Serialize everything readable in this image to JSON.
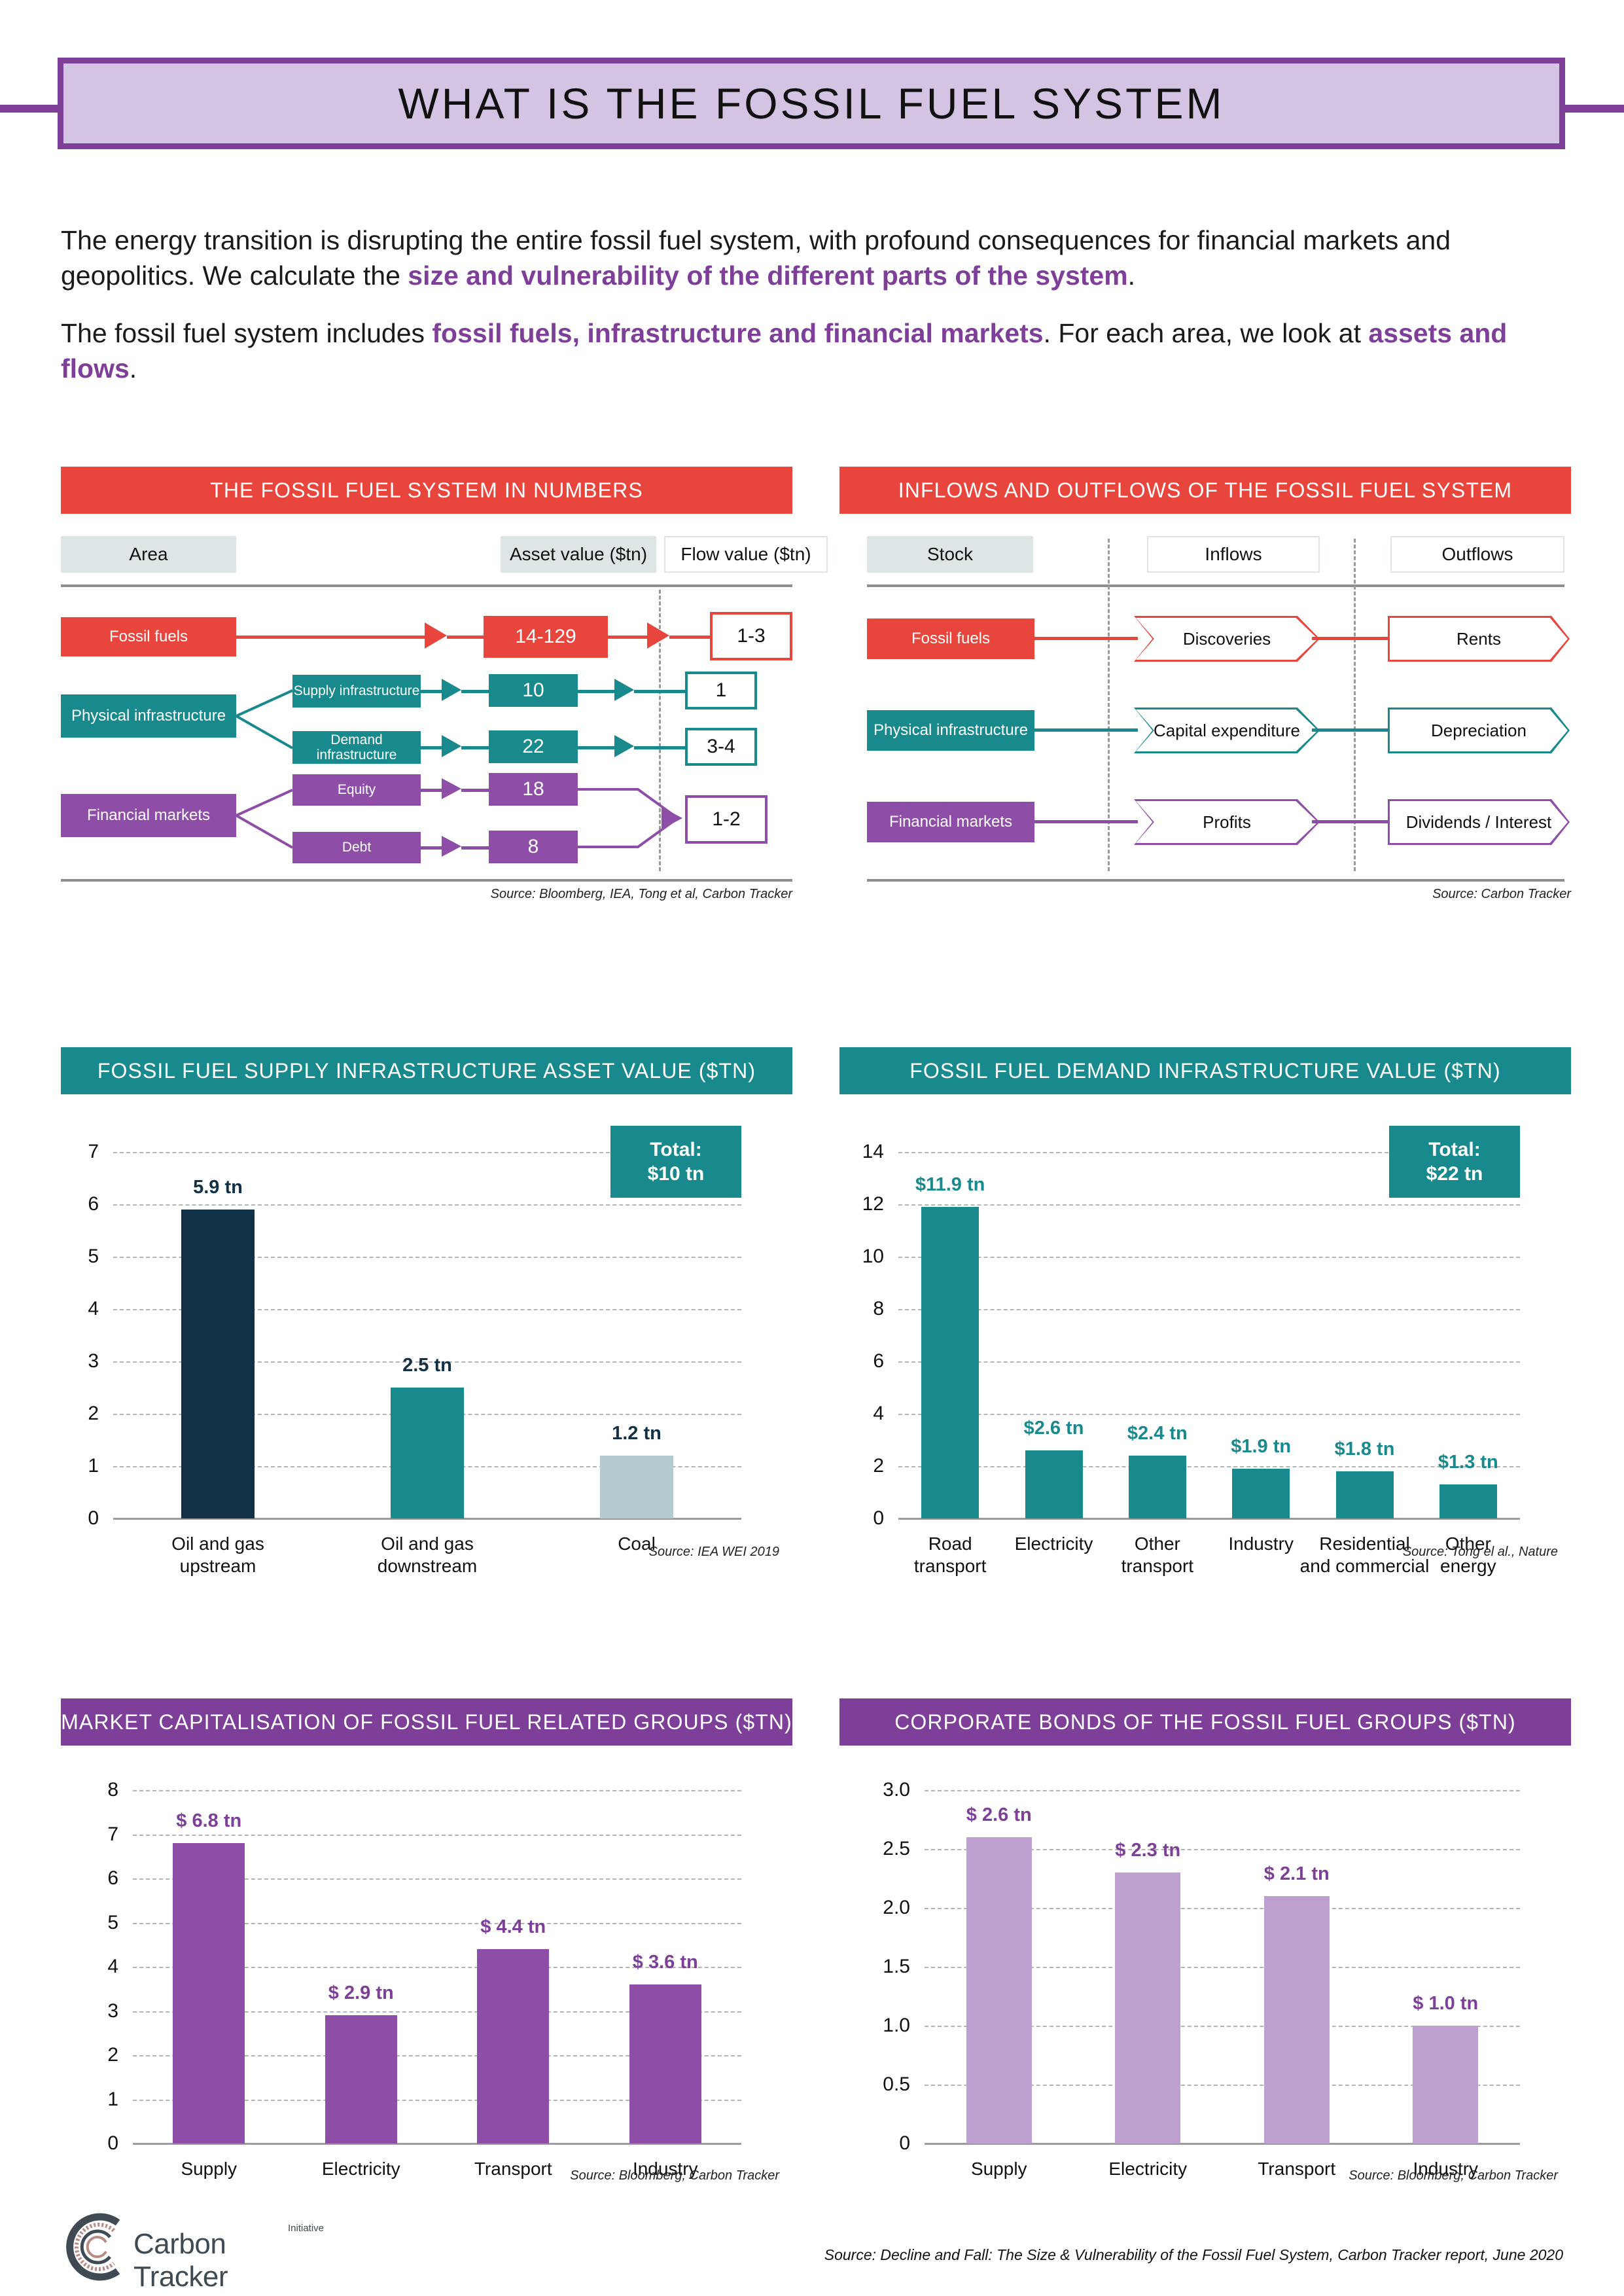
{
  "header": {
    "title": "WHAT IS THE FOSSIL FUEL SYSTEM"
  },
  "intro": {
    "p1_a": "The energy transition is disrupting the entire fossil fuel system, with profound consequences for financial markets and geopolitics. We calculate the ",
    "p1_hl": "size and vulnerability of the different parts of the system",
    "p1_b": ".",
    "p2_a": "The fossil fuel system includes ",
    "p2_hl": "fossil fuels, infrastructure and financial markets",
    "p2_b": ". For each area, we look at ",
    "p2_hl2": "assets and flows",
    "p2_c": "."
  },
  "panel_numbers": {
    "title": "THE FOSSIL FUEL SYSTEM IN NUMBERS",
    "columns": {
      "area": "Area",
      "asset": "Asset value ($tn)",
      "flow": "Flow value ($tn)"
    },
    "rows": [
      {
        "area": "Fossil fuels",
        "sub": null,
        "asset": "14-129",
        "flow": "1-3",
        "color": "#e8453c"
      },
      {
        "area": "Physical infrastructure",
        "sub": [
          "Supply infrastructure",
          "Demand infrastructure"
        ],
        "asset": [
          "10",
          "22"
        ],
        "flow": [
          "1",
          "3-4"
        ],
        "color": "#188a8d"
      },
      {
        "area": "Financial markets",
        "sub": [
          "Equity",
          "Debt"
        ],
        "asset": [
          "18",
          "8"
        ],
        "flow": [
          "1-2"
        ],
        "color": "#8e4ea8"
      }
    ],
    "source": "Source: Bloomberg, IEA, Tong et al, Carbon Tracker"
  },
  "panel_flows": {
    "title": "INFLOWS AND OUTFLOWS OF THE FOSSIL FUEL SYSTEM",
    "columns": {
      "stock": "Stock",
      "inflows": "Inflows",
      "outflows": "Outflows"
    },
    "rows": [
      {
        "stock": "Fossil fuels",
        "inflow": "Discoveries",
        "outflow": "Rents",
        "color": "#e8453c"
      },
      {
        "stock": "Physical infrastructure",
        "inflow": "Capital expenditure",
        "outflow": "Depreciation",
        "color": "#188a8d"
      },
      {
        "stock": "Financial markets",
        "inflow": "Profits",
        "outflow": "Dividends / Interest",
        "color": "#8e4ea8"
      }
    ],
    "source": "Source: Carbon Tracker"
  },
  "chart_data": [
    {
      "id": "supply",
      "type": "bar",
      "title": "FOSSIL FUEL SUPPLY INFRASTRUCTURE ASSET VALUE ($TN)",
      "categories": [
        "Oil and gas\nupstream",
        "Oil and gas\ndownstream",
        "Coal"
      ],
      "values": [
        5.9,
        2.5,
        1.2
      ],
      "labels": [
        "5.9 tn",
        "2.5 tn",
        "1.2 tn"
      ],
      "bar_colors": [
        "#123046",
        "#188a8d",
        "#b3cbcf"
      ],
      "label_color": "#123046",
      "ylim": [
        0,
        7
      ],
      "yticks": [
        0,
        1,
        2,
        3,
        4,
        5,
        6,
        7
      ],
      "ytick_labels": [
        "0",
        "1",
        "2",
        "3",
        "4",
        "5",
        "6",
        "7"
      ],
      "grid": true,
      "total_label": "Total:",
      "total_value": "$10 tn",
      "total_bg": "#188a8d",
      "xlabel": "",
      "ylabel": "",
      "source": "Source: IEA WEI 2019"
    },
    {
      "id": "demand",
      "type": "bar",
      "title": "FOSSIL FUEL DEMAND INFRASTRUCTURE VALUE ($TN)",
      "categories": [
        "Road\ntransport",
        "Electricity",
        "Other\ntransport",
        "Industry",
        "Residential\nand commercial",
        "Other\nenergy"
      ],
      "values": [
        11.9,
        2.6,
        2.4,
        1.9,
        1.8,
        1.3
      ],
      "labels": [
        "$11.9 tn",
        "$2.6 tn",
        "$2.4 tn",
        "$1.9 tn",
        "$1.8 tn",
        "$1.3 tn"
      ],
      "bar_colors": [
        "#188a8d",
        "#188a8d",
        "#188a8d",
        "#188a8d",
        "#188a8d",
        "#188a8d"
      ],
      "label_color": "#188a8d",
      "ylim": [
        0,
        14
      ],
      "yticks": [
        0,
        2,
        4,
        6,
        8,
        10,
        12,
        14
      ],
      "ytick_labels": [
        "0",
        "2",
        "4",
        "6",
        "8",
        "10",
        "12",
        "14"
      ],
      "grid": true,
      "total_label": "Total:",
      "total_value": "$22 tn",
      "total_bg": "#188a8d",
      "xlabel": "",
      "ylabel": "",
      "source": "Source: Tong el al., Nature"
    },
    {
      "id": "marketcap",
      "type": "bar",
      "title": "MARKET CAPITALISATION OF FOSSIL FUEL RELATED GROUPS ($TN)",
      "categories": [
        "Supply",
        "Electricity",
        "Transport",
        "Industry"
      ],
      "values": [
        6.8,
        2.9,
        4.4,
        3.6
      ],
      "labels": [
        "$ 6.8 tn",
        "$ 2.9 tn",
        "$ 4.4 tn",
        "$ 3.6 tn"
      ],
      "bar_colors": [
        "#8e4ea8",
        "#8e4ea8",
        "#8e4ea8",
        "#8e4ea8"
      ],
      "label_color": "#7d3f98",
      "ylim": [
        0,
        8
      ],
      "yticks": [
        0,
        1,
        2,
        3,
        4,
        5,
        6,
        7,
        8
      ],
      "ytick_labels": [
        "0",
        "1",
        "2",
        "3",
        "4",
        "5",
        "6",
        "7",
        "8"
      ],
      "grid": true,
      "xlabel": "",
      "ylabel": "",
      "source": "Source: Bloomberg, Carbon Tracker"
    },
    {
      "id": "bonds",
      "type": "bar",
      "title": "CORPORATE BONDS OF THE FOSSIL FUEL GROUPS ($TN)",
      "categories": [
        "Supply",
        "Electricity",
        "Transport",
        "Industry"
      ],
      "values": [
        2.6,
        2.3,
        2.1,
        1.0
      ],
      "labels": [
        "$ 2.6 tn",
        "$ 2.3 tn",
        "$ 2.1 tn",
        "$ 1.0 tn"
      ],
      "bar_colors": [
        "#bda0d0",
        "#bda0d0",
        "#bda0d0",
        "#bda0d0"
      ],
      "label_color": "#7d3f98",
      "ylim": [
        0,
        3.0
      ],
      "yticks": [
        0,
        0.5,
        1.0,
        1.5,
        2.0,
        2.5,
        3.0
      ],
      "ytick_labels": [
        "0",
        "0.5",
        "1.0",
        "1.5",
        "2.0",
        "2.5",
        "3.0"
      ],
      "grid": true,
      "xlabel": "",
      "ylabel": "",
      "source": "Source: Bloomberg, Carbon Tracker"
    }
  ],
  "footer": {
    "logo_name": "Carbon Tracker",
    "logo_sub": "Initiative",
    "source": "Source: Decline and Fall: The Size & Vulnerability of the Fossil Fuel System, Carbon Tracker report, June 2020"
  }
}
